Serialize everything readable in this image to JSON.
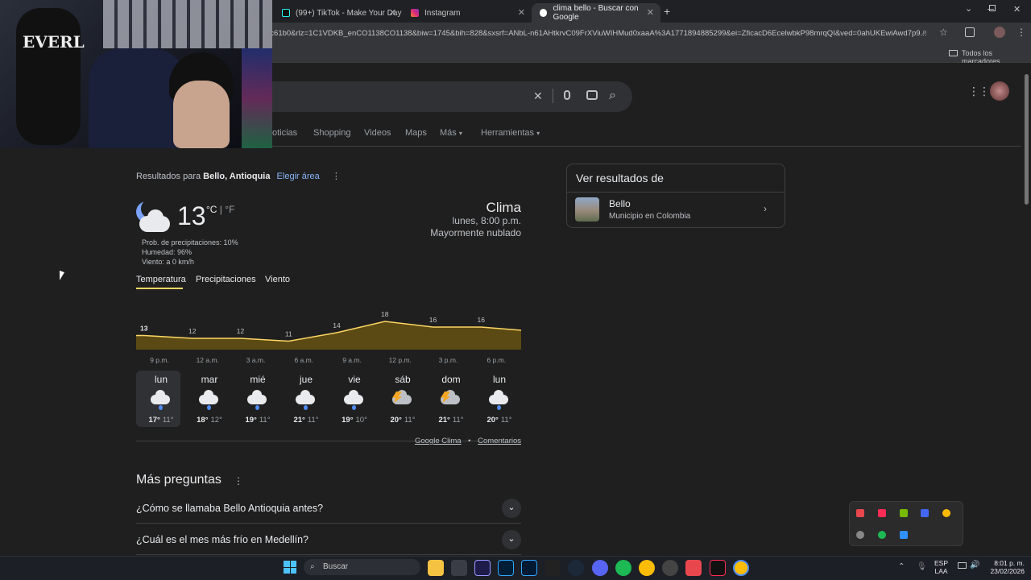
{
  "tabs": [
    {
      "label": "(99+) TikTok - Make Your Day",
      "active": false
    },
    {
      "label": "Instagram",
      "active": false
    },
    {
      "label": "clima bello - Buscar con Google",
      "active": true
    }
  ],
  "omnibox": {
    "url": "1c61b0&rlz=1C1VDKB_enCO1138CO1138&biw=1745&bih=828&sxsrf=ANbL-n61AHtkrvC09FrXViuWIHMud0xaaA%3A1771894885299&ei=ZficacD6EcelwbkP98mrqQI&ved=0ahUKEwiAwd7p9..."
  },
  "bookmarks": {
    "all_label": "Todos los marcadores"
  },
  "nav_tabs": [
    "oticias",
    "Shopping",
    "Videos",
    "Maps",
    "Más",
    "Herramientas"
  ],
  "results": {
    "prefix": "Resultados para ",
    "location": "Bello, Antioquia",
    "choose_area": "Elegir área"
  },
  "weather": {
    "temp": "13",
    "unit_c": "°C",
    "unit_sep": " | ",
    "unit_f": "°F",
    "precip": "Prob. de precipitaciones: 10%",
    "humidity": "Humedad: 96%",
    "wind": "Viento: a 0 km/h",
    "title": "Clima",
    "datetime": "lunes, 8:00 p.m.",
    "condition": "Mayormente nublado",
    "tabs": [
      "Temperatura",
      "Precipitaciones",
      "Viento"
    ],
    "footer_link1": "Google Clima",
    "footer_sep": "•",
    "footer_link2": "Comentarios"
  },
  "chart_data": {
    "type": "area",
    "x": [
      "9 p.m.",
      "12 a.m.",
      "3 a.m.",
      "6 a.m.",
      "9 a.m.",
      "12 p.m.",
      "3 p.m.",
      "6 p.m."
    ],
    "values": [
      13,
      12,
      12,
      11,
      14,
      18,
      16,
      16
    ],
    "ylim": [
      8,
      20
    ],
    "color": "#fdd663"
  },
  "forecast": [
    {
      "day": "lun",
      "hi": "17°",
      "lo": "11°",
      "icon": "rain-cloud-icon"
    },
    {
      "day": "mar",
      "hi": "18°",
      "lo": "12°",
      "icon": "rain-cloud-icon"
    },
    {
      "day": "mié",
      "hi": "19°",
      "lo": "11°",
      "icon": "rain-cloud-icon"
    },
    {
      "day": "jue",
      "hi": "21°",
      "lo": "11°",
      "icon": "rain-cloud-icon"
    },
    {
      "day": "vie",
      "hi": "19°",
      "lo": "10°",
      "icon": "rain-cloud-icon"
    },
    {
      "day": "sáb",
      "hi": "20°",
      "lo": "11°",
      "icon": "thunderstorm-icon"
    },
    {
      "day": "dom",
      "hi": "21°",
      "lo": "11°",
      "icon": "thunderstorm-icon"
    },
    {
      "day": "lun",
      "hi": "20°",
      "lo": "11°",
      "icon": "rain-cloud-icon"
    }
  ],
  "side_panel": {
    "heading": "Ver resultados de",
    "entity_name": "Bello",
    "entity_desc": "Municipio en Colombia"
  },
  "questions": {
    "heading": "Más preguntas",
    "items": [
      "¿Cómo se llamaba Bello Antioquia antes?",
      "¿Cuál es el mes más frío en Medellín?"
    ]
  },
  "taskbar": {
    "search_placeholder": "Buscar",
    "lang1": "ESP",
    "lang2": "LAA",
    "time": "8:01 p. m.",
    "date": "23/02/2026"
  },
  "webcam": {
    "bag_text": "EVERL"
  }
}
